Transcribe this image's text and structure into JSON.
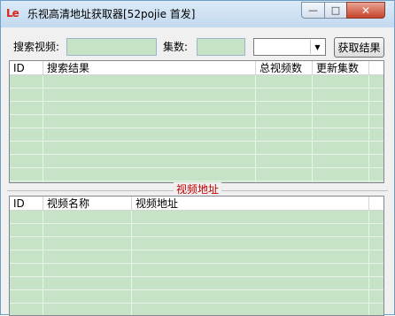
{
  "window": {
    "logo_text": "Le",
    "title": "乐视高清地址获取器[52pojie 首发]",
    "minimize_glyph": "—",
    "maximize_glyph": "□",
    "close_glyph": "✕"
  },
  "toolbar": {
    "search_label": "搜索视频:",
    "search_value": "",
    "episodes_label": "集数:",
    "episodes_value": "",
    "select_value": "",
    "fetch_button": "获取结果"
  },
  "results_table": {
    "columns": [
      "ID",
      "搜索结果",
      "总视频数",
      "更新集数"
    ],
    "rows": []
  },
  "address_group": {
    "title": "视频地址"
  },
  "address_table": {
    "columns": [
      "ID",
      "视频名称",
      "视频地址"
    ],
    "rows": []
  },
  "icons": {
    "dropdown": "chevron-down-icon",
    "logo": "letv-logo-icon"
  },
  "colors": {
    "list_background": "#c7e3c7",
    "group_title": "#c00000",
    "logo": "#d8261f"
  }
}
